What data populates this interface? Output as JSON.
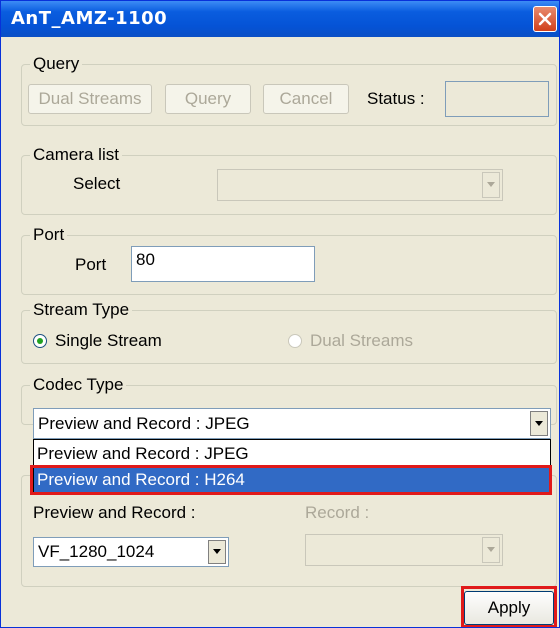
{
  "window": {
    "title": "AnT_AMZ-1100",
    "close_icon": "close-icon"
  },
  "query": {
    "legend": "Query",
    "dual_streams_label": "Dual Streams",
    "query_label": "Query",
    "cancel_label": "Cancel",
    "status_label": "Status :",
    "status_value": ""
  },
  "camera_list": {
    "legend": "Camera list",
    "select_label": "Select",
    "select_value": ""
  },
  "port": {
    "legend": "Port",
    "port_label": "Port",
    "port_value": "80"
  },
  "stream_type": {
    "legend": "Stream Type",
    "single_label": "Single Stream",
    "dual_label": "Dual Streams",
    "selected": "Single Stream"
  },
  "codec_type": {
    "legend": "Codec Type",
    "selected": "Preview and Record : JPEG",
    "options": [
      "Preview and Record : JPEG",
      "Preview and Record : H264"
    ],
    "highlighted": "Preview and Record : H264"
  },
  "resolution": {
    "preview_record_label": "Preview and Record :",
    "record_label": "Record :",
    "preview_record_value": "VF_1280_1024",
    "record_value": ""
  },
  "footer": {
    "apply_label": "Apply"
  },
  "colors": {
    "highlight": "#e01a1a",
    "selection": "#316ac5",
    "titlebar": "#0553d6"
  }
}
